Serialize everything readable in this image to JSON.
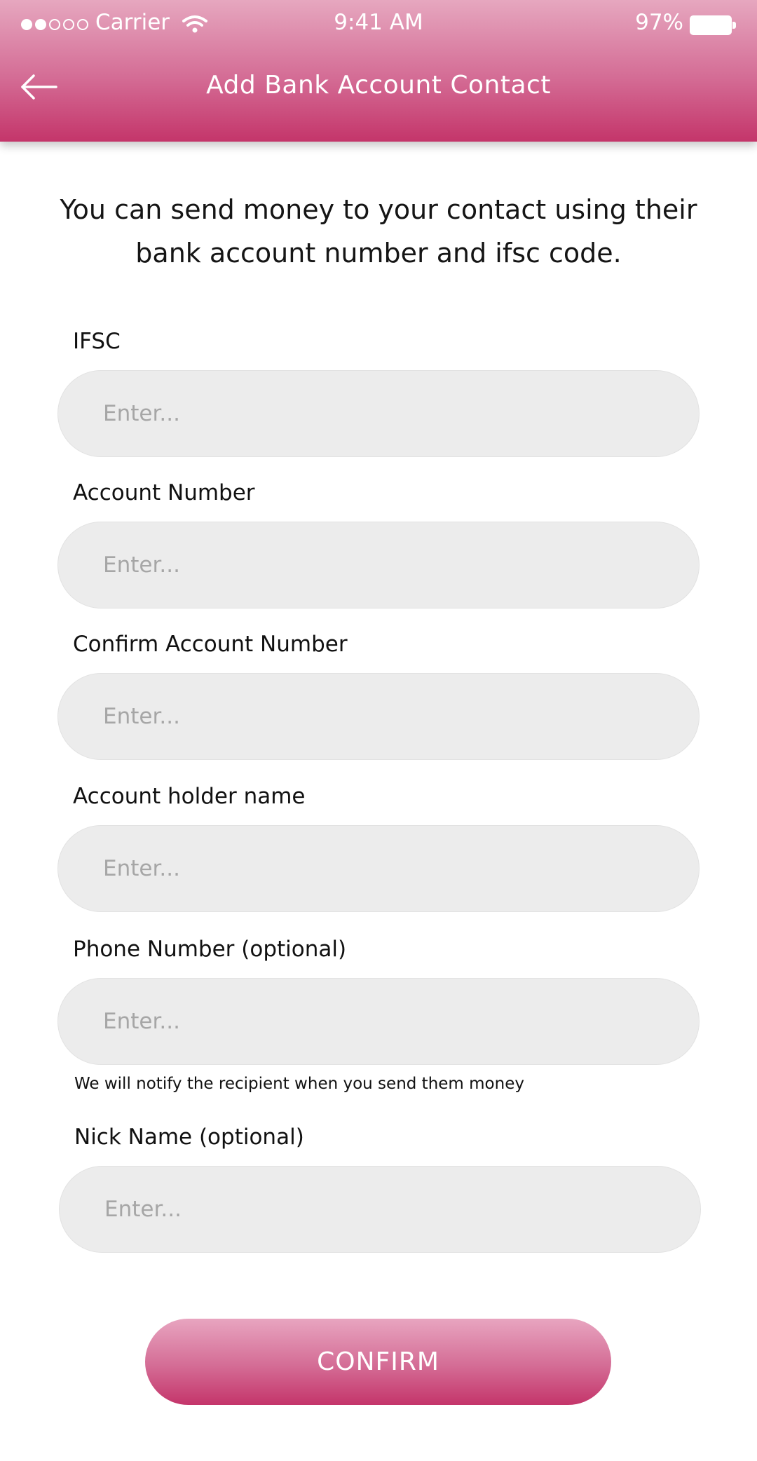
{
  "status_bar": {
    "carrier": "Carrier",
    "time": "9:41 AM",
    "battery_percent": "97%"
  },
  "header": {
    "title": "Add Bank Account Contact",
    "back_icon": "arrow-left-icon"
  },
  "intro": "You can send money to your contact using their bank account number and ifsc code.",
  "fields": [
    {
      "label": "IFSC",
      "placeholder": "Enter...",
      "value": ""
    },
    {
      "label": "Account Number",
      "placeholder": "Enter...",
      "value": ""
    },
    {
      "label": "Confirm Account Number",
      "placeholder": "Enter...",
      "value": ""
    },
    {
      "label": "Account holder name",
      "placeholder": "Enter...",
      "value": ""
    },
    {
      "label": "Phone Number (optional)",
      "placeholder": "Enter...",
      "value": ""
    },
    {
      "label": "Nick Name (optional)",
      "placeholder": "Enter...",
      "value": ""
    }
  ],
  "phone_hint": "We will notify the recipient when you send them money",
  "confirm_label": "CONFIRM",
  "colors": {
    "accent_top": "#e6a7bf",
    "accent_bottom": "#c4356a",
    "field_bg": "#ececec",
    "placeholder": "#a6a6a6"
  }
}
